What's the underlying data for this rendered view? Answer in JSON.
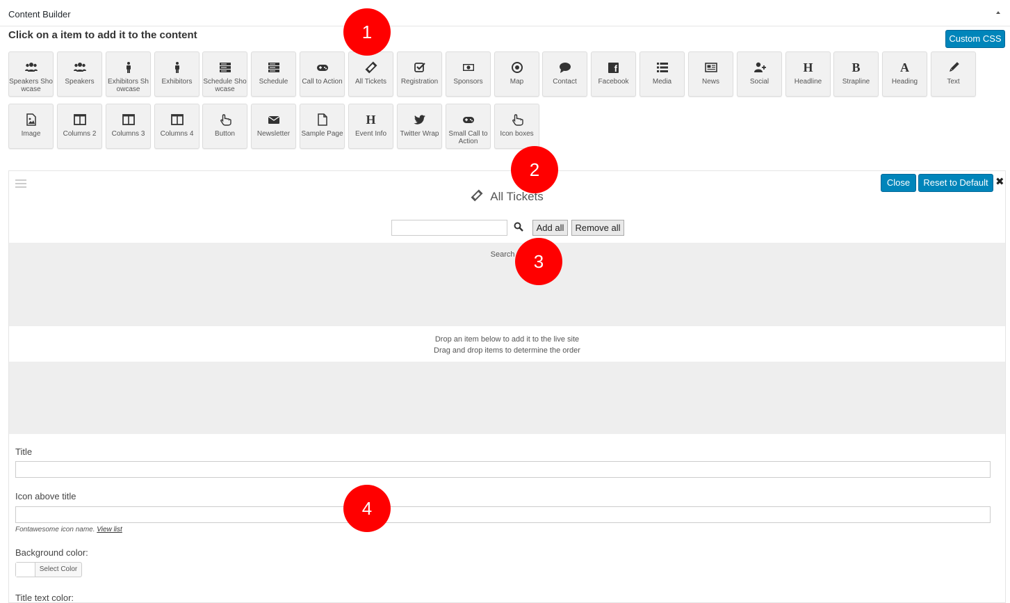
{
  "panel": {
    "title": "Content Builder"
  },
  "instructions": "Click on a item to add it to the content",
  "custom_css_label": "Custom CSS",
  "tiles": [
    {
      "label": "Speakers Sho wcase",
      "icon": "users-icon"
    },
    {
      "label": "Speakers",
      "icon": "users-icon"
    },
    {
      "label": "Exhibitors Sh owcase",
      "icon": "person-icon"
    },
    {
      "label": "Exhibitors",
      "icon": "person-icon"
    },
    {
      "label": "Schedule Sho wcase",
      "icon": "server-icon"
    },
    {
      "label": "Schedule",
      "icon": "server-icon"
    },
    {
      "label": "Call to Action",
      "icon": "gamepad-icon"
    },
    {
      "label": "All Tickets",
      "icon": "ticket-icon"
    },
    {
      "label": "Registration",
      "icon": "check-square-icon"
    },
    {
      "label": "Sponsors",
      "icon": "money-icon"
    },
    {
      "label": "Map",
      "icon": "dot-circle-icon"
    },
    {
      "label": "Contact",
      "icon": "comment-icon"
    },
    {
      "label": "Facebook",
      "icon": "facebook-icon",
      "glyph": "f"
    },
    {
      "label": "Media",
      "icon": "list-icon"
    },
    {
      "label": "News",
      "icon": "newspaper-icon"
    },
    {
      "label": "Social",
      "icon": "user-plus-icon"
    },
    {
      "label": "Headline",
      "icon": "headline-icon",
      "glyph": "H"
    },
    {
      "label": "Strapline",
      "icon": "bold-icon",
      "glyph": "B"
    },
    {
      "label": "Heading",
      "icon": "heading-icon",
      "glyph": "A"
    },
    {
      "label": "Text",
      "icon": "pencil-icon"
    },
    {
      "label": "Image",
      "icon": "image-icon"
    },
    {
      "label": "Columns 2",
      "icon": "columns-icon"
    },
    {
      "label": "Columns 3",
      "icon": "columns-icon"
    },
    {
      "label": "Columns 4",
      "icon": "columns-icon"
    },
    {
      "label": "Button",
      "icon": "hand-pointer-icon"
    },
    {
      "label": "Newsletter",
      "icon": "envelope-icon"
    },
    {
      "label": "Sample Page",
      "icon": "file-icon"
    },
    {
      "label": "Event Info",
      "icon": "event-info-icon",
      "glyph": "H"
    },
    {
      "label": "Twitter Wrap",
      "icon": "twitter-icon"
    },
    {
      "label": "Small Call to Action",
      "icon": "gamepad-icon"
    },
    {
      "label": "Icon boxes",
      "icon": "hand-pointer-icon"
    }
  ],
  "section": {
    "title": "All Tickets",
    "close_label": "Close",
    "reset_label": "Reset to Default",
    "close_x": "✖",
    "search_value": "",
    "add_all_label": "Add all",
    "remove_all_label": "Remove all",
    "results_text": "Search re",
    "drop_line1": "Drop an item below to add it to the live site",
    "drop_line2": "Drag and drop items to determine the order"
  },
  "form": {
    "title_label": "Title",
    "title_value": "",
    "icon_label": "Icon above title",
    "icon_value": "",
    "icon_hint": "Fontawesome icon name.",
    "icon_hint_link": "View list",
    "bg_color_label": "Background color:",
    "select_color_label": "Select Color",
    "title_color_label": "Title text color:"
  },
  "markers": [
    "1",
    "2",
    "3",
    "4"
  ],
  "colors": {
    "accent": "#0085ba",
    "marker": "#ff0000",
    "tile_bg": "#f1f1f1",
    "results_bg": "#eeeeee"
  }
}
